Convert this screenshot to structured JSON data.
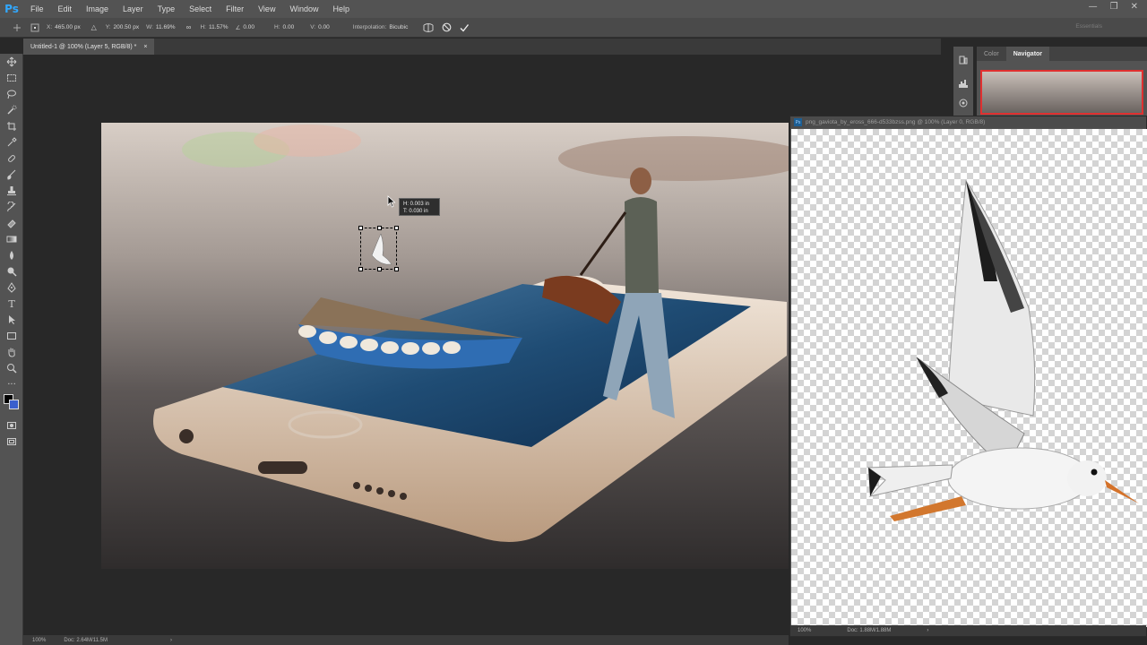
{
  "app": {
    "logo": "Ps"
  },
  "menu": [
    "File",
    "Edit",
    "Image",
    "Layer",
    "Type",
    "Select",
    "Filter",
    "View",
    "Window",
    "Help"
  ],
  "window_controls": [
    "—",
    "❐",
    "✕"
  ],
  "options_bar": {
    "x_label": "X:",
    "x_value": "465.00 px",
    "y_label": "Y:",
    "y_value": "200.50 px",
    "w_label": "W:",
    "w_value": "11.69%",
    "h_label": "H:",
    "h_value": "11.57%",
    "angle_value": "0.00",
    "hskew_label": "H:",
    "hskew_value": "0.00",
    "vskew_label": "V:",
    "vskew_value": "0.00",
    "interp_label": "Interpolation:",
    "interp_value": "Bicubic",
    "workspace": "Essentials"
  },
  "document_tab": {
    "title": "Untitled-1 @ 100% (Layer 5, RGB/8) *",
    "close": "×"
  },
  "transform_tooltip": {
    "line1": "H: 0.003 in",
    "line2": "T: 0.030 in"
  },
  "status_bar": {
    "zoom": "100%",
    "doc": "Doc: 2.64M/11.5M",
    "arrow": "›"
  },
  "panels": {
    "tabs": [
      "Color",
      "Navigator"
    ],
    "active": "Navigator"
  },
  "floating_window": {
    "title": "png_gaviota_by_eross_666-d533bzss.png @ 100% (Layer 0, RGB/8)",
    "zoom": "100%",
    "doc": "Doc: 1.88M/1.88M",
    "arrow": "›"
  },
  "icons": {
    "tools": [
      "move-icon",
      "marquee-icon",
      "lasso-icon",
      "quick-select-icon",
      "crop-icon",
      "eyedropper-icon",
      "healing-brush-icon",
      "brush-icon",
      "clone-stamp-icon",
      "history-brush-icon",
      "eraser-icon",
      "gradient-icon",
      "blur-icon",
      "dodge-icon",
      "pen-icon",
      "type-icon",
      "path-select-icon",
      "rectangle-icon",
      "hand-icon",
      "zoom-icon",
      "more-tools-icon"
    ]
  },
  "colors": {
    "accent": "#31a8ff",
    "foreground": "#000000",
    "background": "#3a5fcd"
  }
}
